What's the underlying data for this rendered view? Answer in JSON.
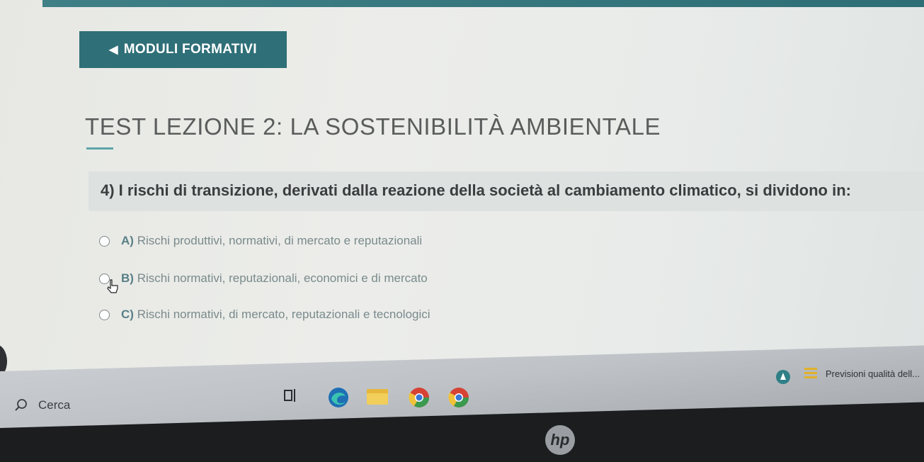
{
  "app": {
    "back_label": "MODULI FORMATIVI",
    "page_title": "TEST LEZIONE 2: LA SOSTENIBILITÀ AMBIENTALE"
  },
  "question": {
    "text": "4) I rischi di transizione, derivati dalla reazione della società al cambiamento climatico, si dividono in:",
    "options": [
      {
        "letter": "A)",
        "text": "Rischi produttivi, normativi, di mercato e reputazionali"
      },
      {
        "letter": "B)",
        "text": "Rischi normativi, reputazionali, economici e di mercato"
      },
      {
        "letter": "C)",
        "text": "Rischi normativi, di mercato, reputazionali e tecnologici"
      }
    ]
  },
  "taskbar": {
    "search_label": "Cerca",
    "weather_text": "Previsioni qualità dell..."
  },
  "laptop": {
    "logo_text": "hp"
  },
  "colors": {
    "accent": "#2f6f78",
    "option_text": "#7a8a8c",
    "title": "#5a5c5c"
  }
}
